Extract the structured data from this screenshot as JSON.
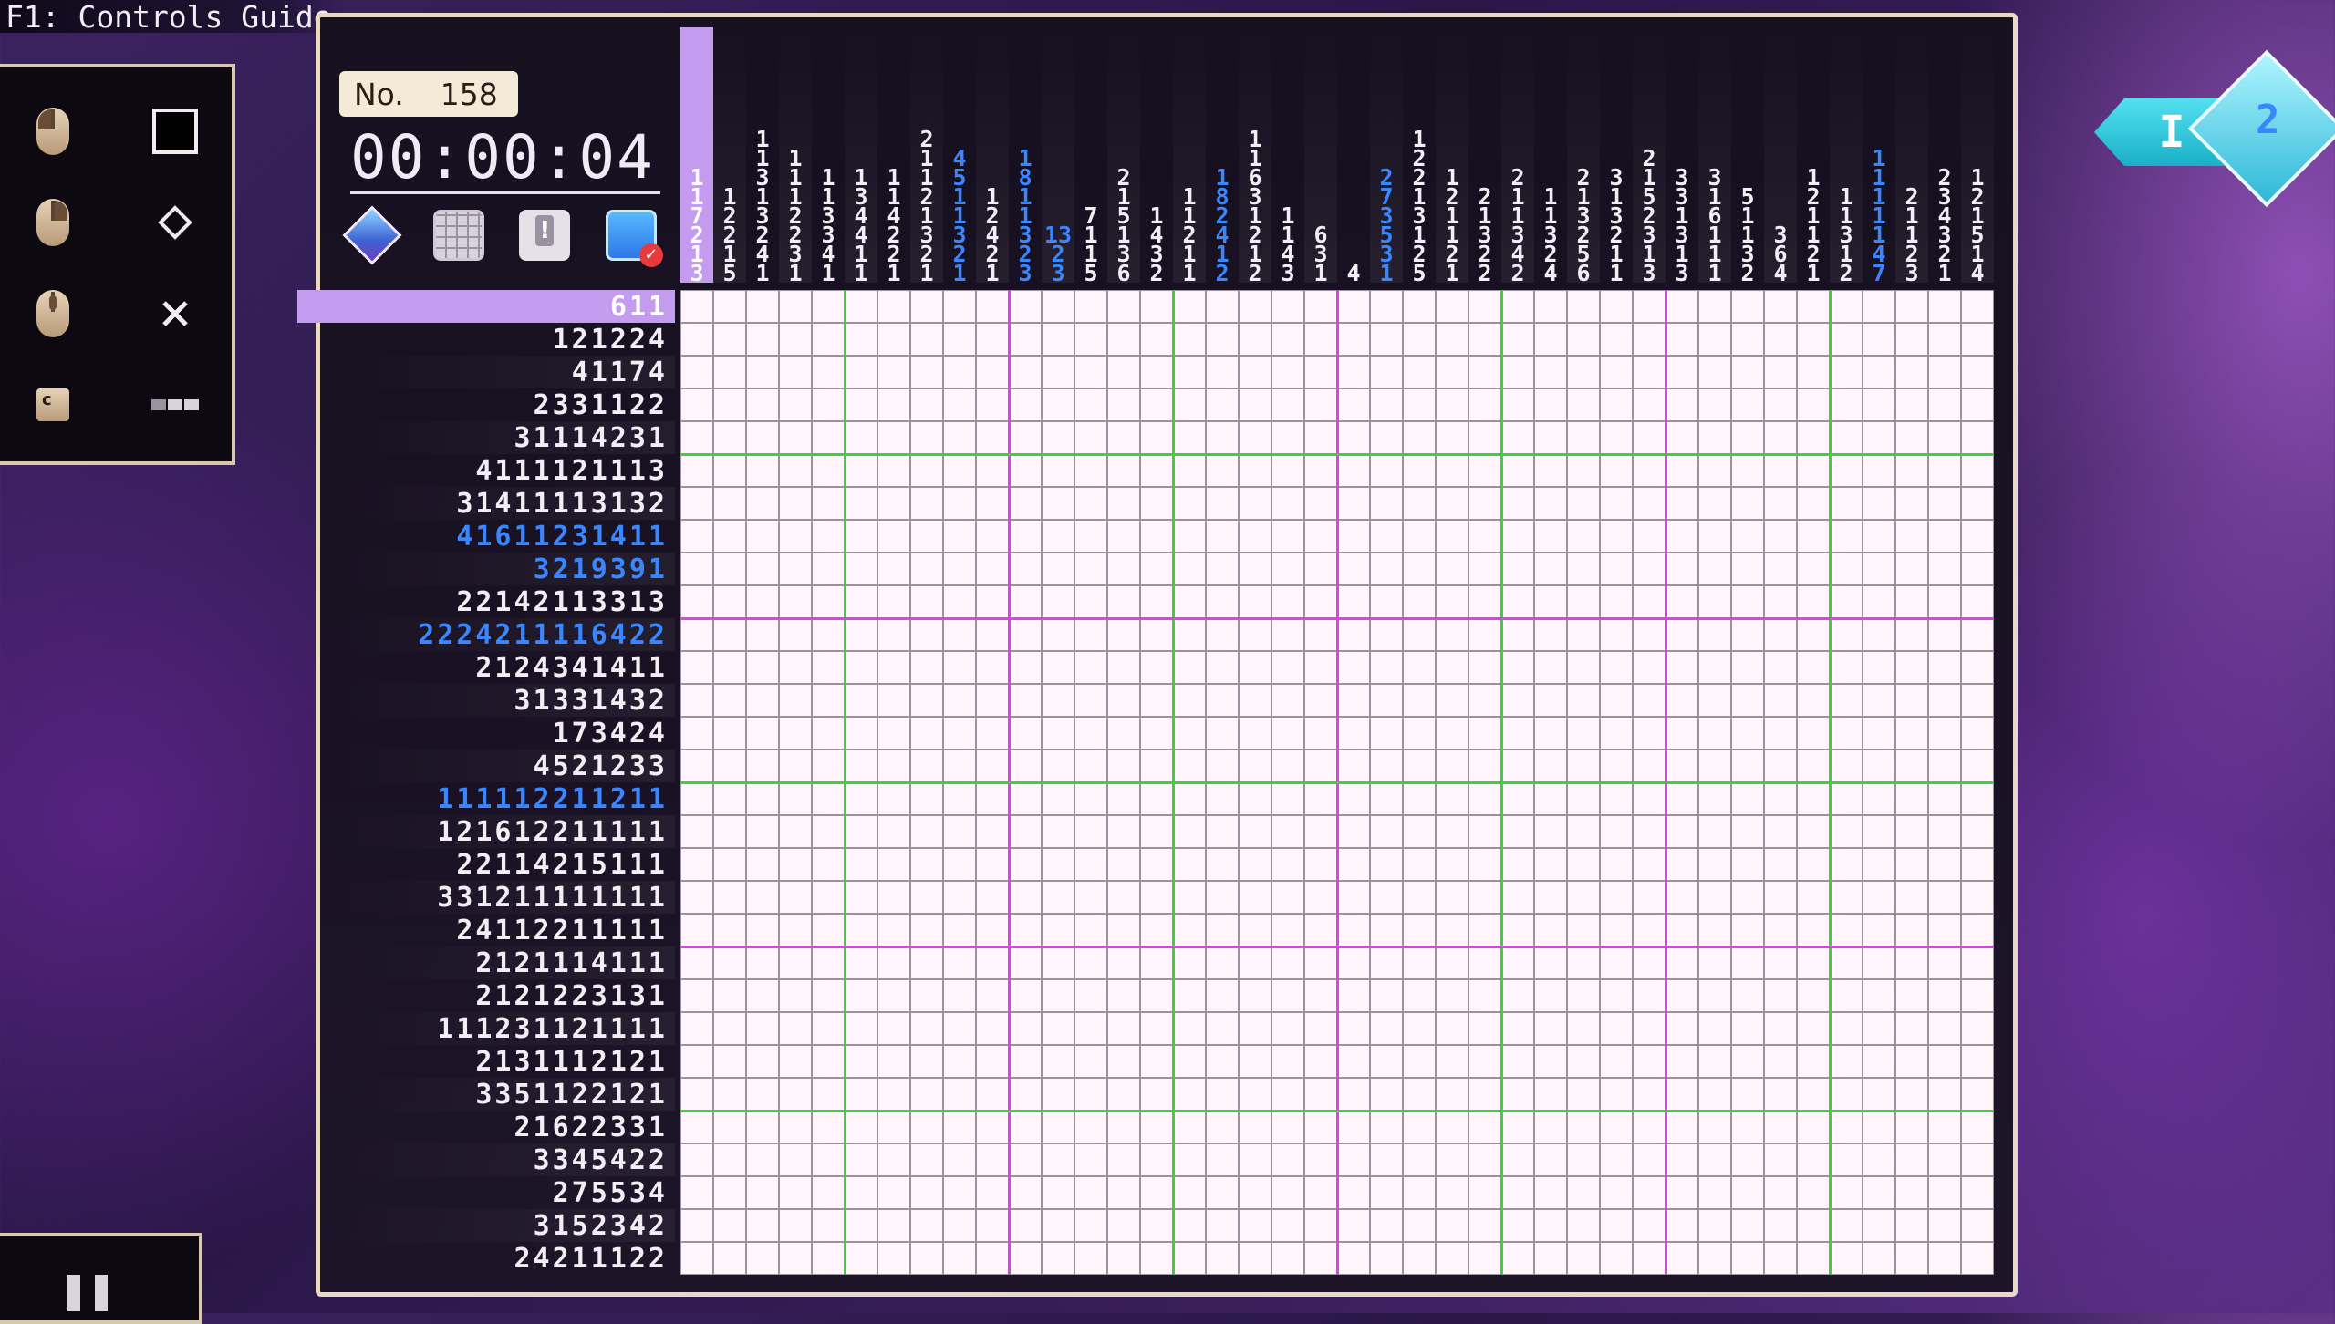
{
  "header": {
    "guide_label": "F1: Controls Guide"
  },
  "puzzle": {
    "no_label": "No.",
    "number": "158",
    "timer": "00:00:04"
  },
  "colors": {
    "grid_minor": "#9a92a0",
    "grid_five": "#3ed03e",
    "grid_ten": "#e040e8",
    "highlight": "#c39cf0",
    "clue_blue": "#3a86ff"
  },
  "legend": [
    {
      "input": "left-click-icon",
      "action": "fill-square-icon"
    },
    {
      "input": "right-click-icon",
      "action": "mark-diamond-icon"
    },
    {
      "input": "middle-click-icon",
      "action": "cross-icon"
    },
    {
      "input": "c-key-icon",
      "action": "toggle-icon"
    }
  ],
  "tools": [
    "hint-gem-icon",
    "grid-icon",
    "alert-icon",
    "mark-check-icon"
  ],
  "nav": {
    "left_label": "I",
    "right_label": "2"
  },
  "row_clues": [
    {
      "text": "611",
      "state": "selected"
    },
    {
      "text": "121224"
    },
    {
      "text": "41174"
    },
    {
      "text": "2331122"
    },
    {
      "text": "31114231"
    },
    {
      "text": "4111121113"
    },
    {
      "text": "31411113132"
    },
    {
      "text": "41611231411",
      "state": "blue"
    },
    {
      "text": "3219391",
      "state": "blue"
    },
    {
      "text": "22142113313"
    },
    {
      "text": "2224211116422",
      "state": "blue"
    },
    {
      "text": "2124341411"
    },
    {
      "text": "31331432"
    },
    {
      "text": "173424"
    },
    {
      "text": "4521233"
    },
    {
      "text": "111112211211",
      "state": "blue"
    },
    {
      "text": "121612211111"
    },
    {
      "text": "22114215111"
    },
    {
      "text": "331211111111"
    },
    {
      "text": "24112211111"
    },
    {
      "text": "2121114111"
    },
    {
      "text": "2121223131"
    },
    {
      "text": "111231121111"
    },
    {
      "text": "2131112121"
    },
    {
      "text": "3351122121"
    },
    {
      "text": "21622331"
    },
    {
      "text": "3345422"
    },
    {
      "text": "275534"
    },
    {
      "text": "3152342"
    },
    {
      "text": "24211122"
    }
  ],
  "col_clues": [
    {
      "nums": [
        "1",
        "1",
        "7",
        "2",
        "1",
        "3"
      ],
      "state": "selected"
    },
    {
      "nums": [
        "1",
        "2",
        "2",
        "1",
        "5"
      ]
    },
    {
      "nums": [
        "1",
        "1",
        "3",
        "1",
        "3",
        "2",
        "4",
        "1"
      ]
    },
    {
      "nums": [
        "1",
        "1",
        "1",
        "2",
        "2",
        "3",
        "1"
      ]
    },
    {
      "nums": [
        "1",
        "1",
        "3",
        "3",
        "4",
        "1"
      ]
    },
    {
      "nums": [
        "1",
        "3",
        "4",
        "4",
        "1",
        "1"
      ]
    },
    {
      "nums": [
        "1",
        "1",
        "4",
        "2",
        "2",
        "1"
      ]
    },
    {
      "nums": [
        "2",
        "1",
        "1",
        "2",
        "1",
        "3",
        "2",
        "1"
      ]
    },
    {
      "nums": [
        "4",
        "5",
        "1",
        "1",
        "3",
        "2",
        "1"
      ],
      "state": "blue"
    },
    {
      "nums": [
        "1",
        "2",
        "4",
        "2",
        "1"
      ]
    },
    {
      "nums": [
        "1",
        "8",
        "1",
        "1",
        "3",
        "2",
        "3"
      ],
      "state": "blue"
    },
    {
      "nums": [
        "13",
        "2",
        "3"
      ],
      "state": "blue"
    },
    {
      "nums": [
        "7",
        "1",
        "1",
        "5"
      ]
    },
    {
      "nums": [
        "2",
        "1",
        "5",
        "1",
        "3",
        "6"
      ]
    },
    {
      "nums": [
        "1",
        "4",
        "3",
        "2"
      ]
    },
    {
      "nums": [
        "1",
        "1",
        "2",
        "1",
        "1"
      ]
    },
    {
      "nums": [
        "1",
        "8",
        "2",
        "4",
        "1",
        "2"
      ],
      "state": "blue"
    },
    {
      "nums": [
        "1",
        "1",
        "6",
        "3",
        "1",
        "2",
        "1",
        "2"
      ]
    },
    {
      "nums": [
        "1",
        "1",
        "4",
        "3"
      ]
    },
    {
      "nums": [
        "6",
        "3",
        "1"
      ]
    },
    {
      "nums": [
        "4"
      ]
    },
    {
      "nums": [
        "2",
        "7",
        "3",
        "5",
        "3",
        "1"
      ],
      "state": "blue"
    },
    {
      "nums": [
        "1",
        "2",
        "2",
        "1",
        "3",
        "1",
        "2",
        "5"
      ]
    },
    {
      "nums": [
        "1",
        "2",
        "1",
        "1",
        "2",
        "1"
      ]
    },
    {
      "nums": [
        "2",
        "1",
        "3",
        "2",
        "2"
      ]
    },
    {
      "nums": [
        "2",
        "1",
        "1",
        "3",
        "4",
        "2"
      ]
    },
    {
      "nums": [
        "1",
        "1",
        "3",
        "2",
        "4"
      ]
    },
    {
      "nums": [
        "2",
        "1",
        "3",
        "2",
        "5",
        "6"
      ]
    },
    {
      "nums": [
        "3",
        "1",
        "3",
        "2",
        "1",
        "1"
      ]
    },
    {
      "nums": [
        "2",
        "1",
        "5",
        "2",
        "3",
        "1",
        "3"
      ]
    },
    {
      "nums": [
        "3",
        "3",
        "1",
        "3",
        "1",
        "3"
      ]
    },
    {
      "nums": [
        "3",
        "1",
        "6",
        "1",
        "1",
        "1"
      ]
    },
    {
      "nums": [
        "5",
        "1",
        "1",
        "3",
        "2"
      ]
    },
    {
      "nums": [
        "3",
        "6",
        "4"
      ]
    },
    {
      "nums": [
        "1",
        "2",
        "1",
        "1",
        "2",
        "1"
      ]
    },
    {
      "nums": [
        "1",
        "1",
        "3",
        "1",
        "2"
      ]
    },
    {
      "nums": [
        "1",
        "1",
        "1",
        "1",
        "1",
        "4",
        "7"
      ],
      "state": "blue"
    },
    {
      "nums": [
        "2",
        "1",
        "1",
        "2",
        "3"
      ]
    },
    {
      "nums": [
        "2",
        "3",
        "4",
        "3",
        "2",
        "1"
      ]
    },
    {
      "nums": [
        "1",
        "2",
        "1",
        "5",
        "1",
        "4"
      ]
    }
  ]
}
